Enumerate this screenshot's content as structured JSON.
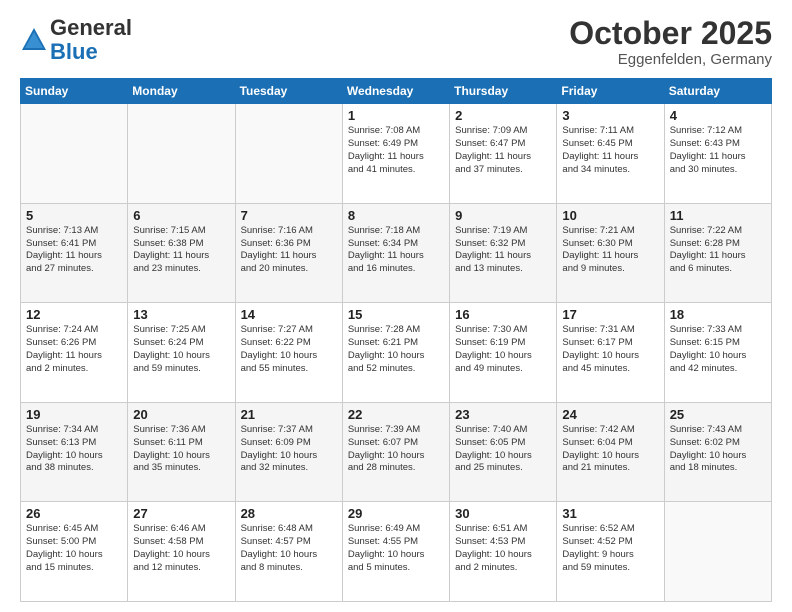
{
  "header": {
    "logo_general": "General",
    "logo_blue": "Blue",
    "month_title": "October 2025",
    "location": "Eggenfelden, Germany"
  },
  "weekdays": [
    "Sunday",
    "Monday",
    "Tuesday",
    "Wednesday",
    "Thursday",
    "Friday",
    "Saturday"
  ],
  "rows": [
    {
      "alt": false,
      "cells": [
        {
          "day": "",
          "content": ""
        },
        {
          "day": "",
          "content": ""
        },
        {
          "day": "",
          "content": ""
        },
        {
          "day": "1",
          "content": "Sunrise: 7:08 AM\nSunset: 6:49 PM\nDaylight: 11 hours\nand 41 minutes."
        },
        {
          "day": "2",
          "content": "Sunrise: 7:09 AM\nSunset: 6:47 PM\nDaylight: 11 hours\nand 37 minutes."
        },
        {
          "day": "3",
          "content": "Sunrise: 7:11 AM\nSunset: 6:45 PM\nDaylight: 11 hours\nand 34 minutes."
        },
        {
          "day": "4",
          "content": "Sunrise: 7:12 AM\nSunset: 6:43 PM\nDaylight: 11 hours\nand 30 minutes."
        }
      ]
    },
    {
      "alt": true,
      "cells": [
        {
          "day": "5",
          "content": "Sunrise: 7:13 AM\nSunset: 6:41 PM\nDaylight: 11 hours\nand 27 minutes."
        },
        {
          "day": "6",
          "content": "Sunrise: 7:15 AM\nSunset: 6:38 PM\nDaylight: 11 hours\nand 23 minutes."
        },
        {
          "day": "7",
          "content": "Sunrise: 7:16 AM\nSunset: 6:36 PM\nDaylight: 11 hours\nand 20 minutes."
        },
        {
          "day": "8",
          "content": "Sunrise: 7:18 AM\nSunset: 6:34 PM\nDaylight: 11 hours\nand 16 minutes."
        },
        {
          "day": "9",
          "content": "Sunrise: 7:19 AM\nSunset: 6:32 PM\nDaylight: 11 hours\nand 13 minutes."
        },
        {
          "day": "10",
          "content": "Sunrise: 7:21 AM\nSunset: 6:30 PM\nDaylight: 11 hours\nand 9 minutes."
        },
        {
          "day": "11",
          "content": "Sunrise: 7:22 AM\nSunset: 6:28 PM\nDaylight: 11 hours\nand 6 minutes."
        }
      ]
    },
    {
      "alt": false,
      "cells": [
        {
          "day": "12",
          "content": "Sunrise: 7:24 AM\nSunset: 6:26 PM\nDaylight: 11 hours\nand 2 minutes."
        },
        {
          "day": "13",
          "content": "Sunrise: 7:25 AM\nSunset: 6:24 PM\nDaylight: 10 hours\nand 59 minutes."
        },
        {
          "day": "14",
          "content": "Sunrise: 7:27 AM\nSunset: 6:22 PM\nDaylight: 10 hours\nand 55 minutes."
        },
        {
          "day": "15",
          "content": "Sunrise: 7:28 AM\nSunset: 6:21 PM\nDaylight: 10 hours\nand 52 minutes."
        },
        {
          "day": "16",
          "content": "Sunrise: 7:30 AM\nSunset: 6:19 PM\nDaylight: 10 hours\nand 49 minutes."
        },
        {
          "day": "17",
          "content": "Sunrise: 7:31 AM\nSunset: 6:17 PM\nDaylight: 10 hours\nand 45 minutes."
        },
        {
          "day": "18",
          "content": "Sunrise: 7:33 AM\nSunset: 6:15 PM\nDaylight: 10 hours\nand 42 minutes."
        }
      ]
    },
    {
      "alt": true,
      "cells": [
        {
          "day": "19",
          "content": "Sunrise: 7:34 AM\nSunset: 6:13 PM\nDaylight: 10 hours\nand 38 minutes."
        },
        {
          "day": "20",
          "content": "Sunrise: 7:36 AM\nSunset: 6:11 PM\nDaylight: 10 hours\nand 35 minutes."
        },
        {
          "day": "21",
          "content": "Sunrise: 7:37 AM\nSunset: 6:09 PM\nDaylight: 10 hours\nand 32 minutes."
        },
        {
          "day": "22",
          "content": "Sunrise: 7:39 AM\nSunset: 6:07 PM\nDaylight: 10 hours\nand 28 minutes."
        },
        {
          "day": "23",
          "content": "Sunrise: 7:40 AM\nSunset: 6:05 PM\nDaylight: 10 hours\nand 25 minutes."
        },
        {
          "day": "24",
          "content": "Sunrise: 7:42 AM\nSunset: 6:04 PM\nDaylight: 10 hours\nand 21 minutes."
        },
        {
          "day": "25",
          "content": "Sunrise: 7:43 AM\nSunset: 6:02 PM\nDaylight: 10 hours\nand 18 minutes."
        }
      ]
    },
    {
      "alt": false,
      "cells": [
        {
          "day": "26",
          "content": "Sunrise: 6:45 AM\nSunset: 5:00 PM\nDaylight: 10 hours\nand 15 minutes."
        },
        {
          "day": "27",
          "content": "Sunrise: 6:46 AM\nSunset: 4:58 PM\nDaylight: 10 hours\nand 12 minutes."
        },
        {
          "day": "28",
          "content": "Sunrise: 6:48 AM\nSunset: 4:57 PM\nDaylight: 10 hours\nand 8 minutes."
        },
        {
          "day": "29",
          "content": "Sunrise: 6:49 AM\nSunset: 4:55 PM\nDaylight: 10 hours\nand 5 minutes."
        },
        {
          "day": "30",
          "content": "Sunrise: 6:51 AM\nSunset: 4:53 PM\nDaylight: 10 hours\nand 2 minutes."
        },
        {
          "day": "31",
          "content": "Sunrise: 6:52 AM\nSunset: 4:52 PM\nDaylight: 9 hours\nand 59 minutes."
        },
        {
          "day": "",
          "content": ""
        }
      ]
    }
  ]
}
